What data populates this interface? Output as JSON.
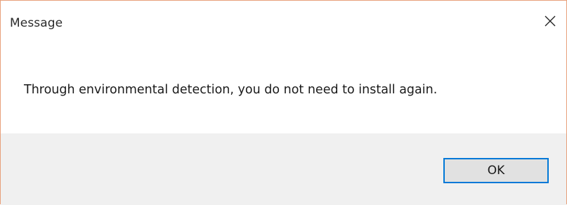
{
  "dialog": {
    "title": "Message",
    "message": "Through environmental detection, you do not need to install again.",
    "ok_label": "OK",
    "close_icon": "close-icon"
  },
  "colors": {
    "border": "#e8a07a",
    "footer_bg": "#f0f0f0",
    "button_bg": "#e1e1e1",
    "button_focus_border": "#0078d7"
  }
}
